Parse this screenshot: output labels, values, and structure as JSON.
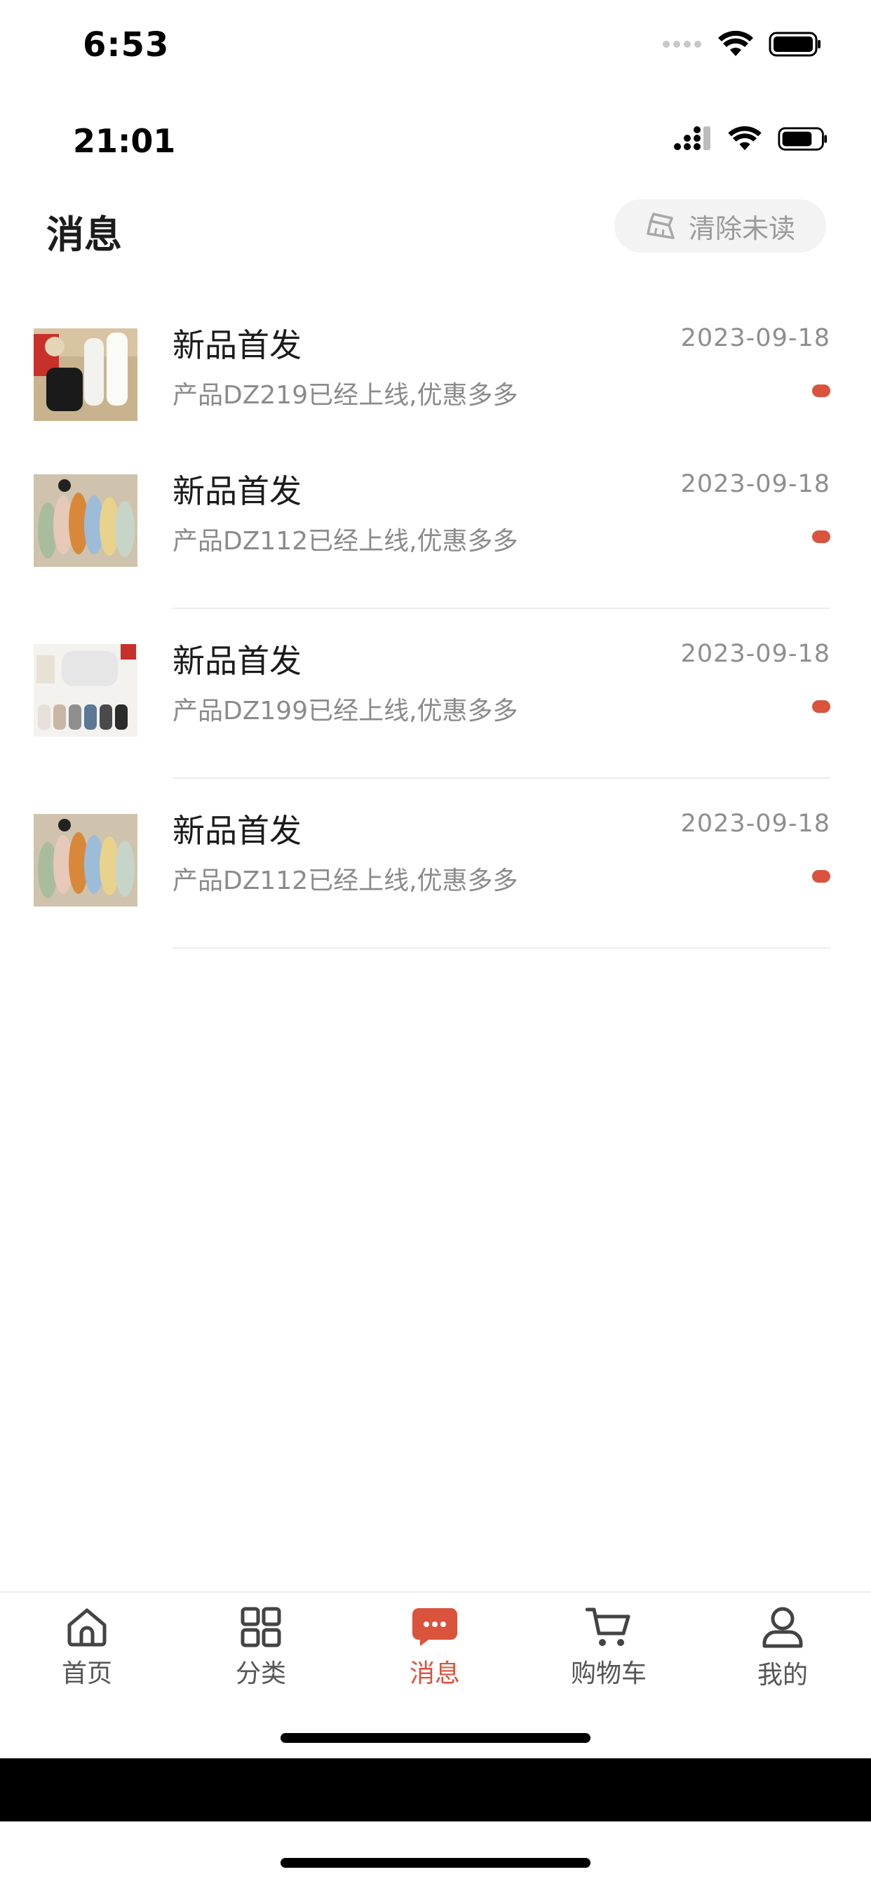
{
  "status_outer": {
    "time": "6:53"
  },
  "status_inner": {
    "time": "21:01"
  },
  "header": {
    "title": "消息",
    "clear_label": "清除未读"
  },
  "messages": [
    {
      "title": "新品首发",
      "date": "2023-09-18",
      "body": "产品DZ219已经上线,优惠多多",
      "unread": true
    },
    {
      "title": "新品首发",
      "date": "2023-09-18",
      "body": "产品DZ112已经上线,优惠多多",
      "unread": true
    },
    {
      "title": "新品首发",
      "date": "2023-09-18",
      "body": "产品DZ199已经上线,优惠多多",
      "unread": true
    },
    {
      "title": "新品首发",
      "date": "2023-09-18",
      "body": "产品DZ112已经上线,优惠多多",
      "unread": true
    }
  ],
  "tabbar": {
    "items": [
      {
        "label": "首页",
        "icon": "home-icon"
      },
      {
        "label": "分类",
        "icon": "grid-icon"
      },
      {
        "label": "消息",
        "icon": "message-icon",
        "active": true
      },
      {
        "label": "购物车",
        "icon": "cart-icon"
      },
      {
        "label": "我的",
        "icon": "user-icon"
      }
    ]
  },
  "colors": {
    "accent": "#d9533d",
    "muted_text": "#8b8b8b"
  }
}
